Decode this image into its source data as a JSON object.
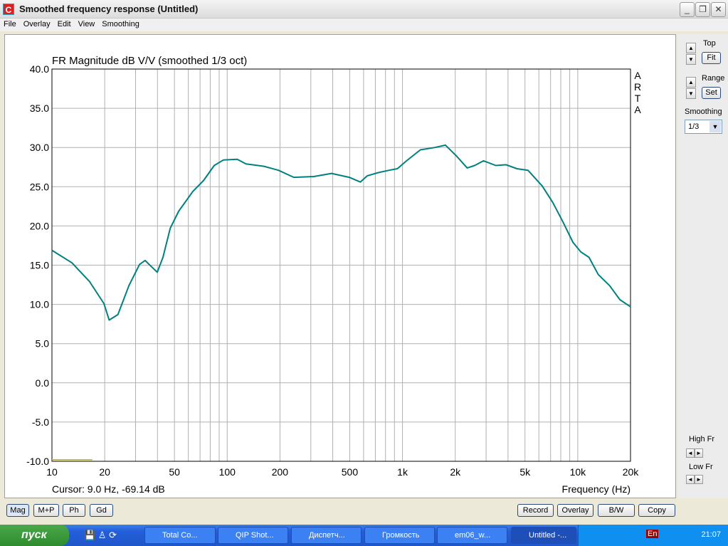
{
  "window": {
    "title": "Smoothed frequency response (Untitled)",
    "controls": [
      "_",
      "❐",
      "✕"
    ]
  },
  "menu": [
    "File",
    "Overlay",
    "Edit",
    "View",
    "Smoothing"
  ],
  "side": {
    "top_label": "Top",
    "fit": "Fit",
    "range_label": "Range",
    "set": "Set",
    "smoothing_label": "Smoothing",
    "smoothing_value": "1/3",
    "high_fr": "High Fr",
    "low_fr": "Low Fr"
  },
  "bottom": {
    "mag": "Mag",
    "mp": "M+P",
    "ph": "Ph",
    "gd": "Gd",
    "record": "Record",
    "overlay": "Overlay",
    "bw": "B/W",
    "copy": "Copy"
  },
  "taskbar": {
    "start": "пуск",
    "tasks": [
      "Total Co...",
      "QIP Shot...",
      "Диспетч...",
      "Громкость",
      "em06_w...",
      "Untitled -..."
    ],
    "clock": "21:07",
    "lang": "En"
  },
  "chart_data": {
    "type": "line",
    "title": "FR Magnitude dB V/V (smoothed 1/3 oct)",
    "watermark": "ARTA",
    "xlabel": "Frequency (Hz)",
    "cursor": "Cursor: 9.0 Hz, -69.14 dB",
    "xscale": "log",
    "xlim": [
      10,
      20000
    ],
    "ylim": [
      -10,
      40
    ],
    "grid": true,
    "xticks": [
      {
        "v": 10,
        "l": "10"
      },
      {
        "v": 20,
        "l": "20"
      },
      {
        "v": 50,
        "l": "50"
      },
      {
        "v": 100,
        "l": "100"
      },
      {
        "v": 200,
        "l": "200"
      },
      {
        "v": 500,
        "l": "500"
      },
      {
        "v": 1000,
        "l": "1k"
      },
      {
        "v": 2000,
        "l": "2k"
      },
      {
        "v": 5000,
        "l": "5k"
      },
      {
        "v": 10000,
        "l": "10k"
      },
      {
        "v": 20000,
        "l": "20k"
      }
    ],
    "yticks": [
      "40.0",
      "35.0",
      "30.0",
      "25.0",
      "20.0",
      "15.0",
      "10.0",
      "5.0",
      "0.0",
      "-5.0",
      "-10.0"
    ],
    "series": [
      {
        "color": "#008080",
        "x": [
          10,
          13,
          16.4,
          19.8,
          21.2,
          23.8,
          27.5,
          31.6,
          34,
          37,
          39.9,
          43,
          47.3,
          52.9,
          63.7,
          73.3,
          84.3,
          95,
          114,
          128,
          162,
          196,
          240,
          312,
          394,
          497,
          575,
          630,
          728,
          838,
          935,
          1055,
          1265,
          1530,
          1760,
          2035,
          2340,
          2580,
          2900,
          3410,
          3900,
          4500,
          5200,
          6270,
          7200,
          8200,
          9400,
          10400,
          11600,
          13100,
          15200,
          17400,
          20000
        ],
        "y": [
          16.9,
          15.3,
          12.9,
          10.1,
          8.0,
          8.7,
          12.4,
          15.1,
          15.6,
          14.8,
          14.1,
          16.0,
          19.7,
          21.9,
          24.4,
          25.8,
          27.7,
          28.4,
          28.5,
          27.9,
          27.6,
          27.1,
          26.2,
          26.3,
          26.7,
          26.2,
          25.6,
          26.4,
          26.8,
          27.1,
          27.3,
          28.3,
          29.7,
          30.0,
          30.3,
          28.9,
          27.4,
          27.7,
          28.3,
          27.7,
          27.8,
          27.3,
          27.1,
          25.1,
          23.0,
          20.6,
          17.9,
          16.7,
          16.0,
          13.8,
          12.4,
          10.6,
          9.7
        ]
      },
      {
        "color": "#c8b400",
        "x": [
          10,
          17
        ],
        "y": [
          -9.8,
          -9.8
        ]
      }
    ]
  }
}
